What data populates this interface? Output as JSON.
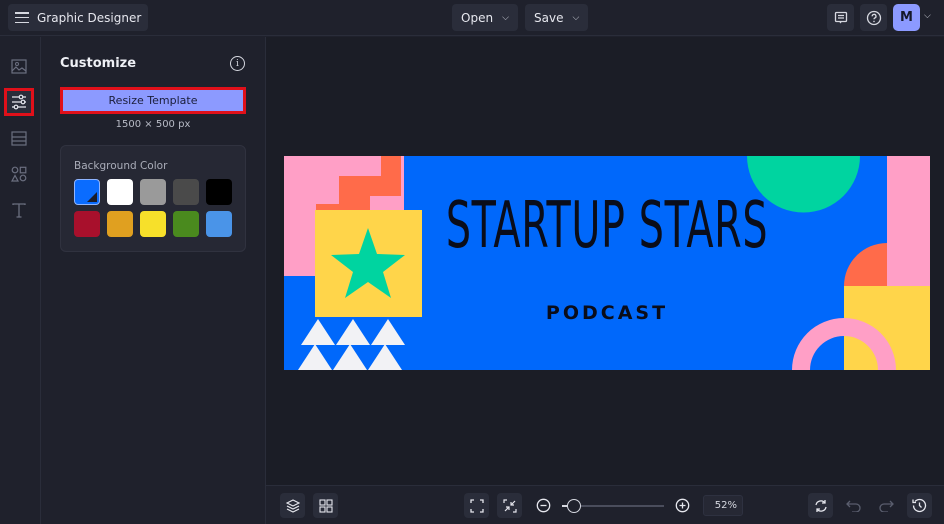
{
  "topbar": {
    "app_title": "Graphic Designer",
    "open_label": "Open",
    "save_label": "Save",
    "avatar_initial": "M",
    "icons": [
      "menu-icon",
      "feedback-icon",
      "help-icon",
      "chevron-down-icon"
    ]
  },
  "rail": {
    "items": [
      {
        "name": "image-icon",
        "active": false
      },
      {
        "name": "customize-sliders-icon",
        "active": true
      },
      {
        "name": "layout-icon",
        "active": false
      },
      {
        "name": "shapes-icon",
        "active": false
      },
      {
        "name": "text-icon",
        "active": false
      }
    ]
  },
  "panel": {
    "title": "Customize",
    "resize_label": "Resize Template",
    "dimensions": "1500 × 500 px",
    "background_color_label": "Background Color",
    "swatches": [
      {
        "color": "#0a6cff",
        "selected": true
      },
      {
        "color": "#ffffff",
        "selected": false
      },
      {
        "color": "#9a9a9a",
        "selected": false
      },
      {
        "color": "#4a4a4a",
        "selected": false
      },
      {
        "color": "#000000",
        "selected": false
      },
      {
        "color": "#a8102c",
        "selected": false
      },
      {
        "color": "#e0a020",
        "selected": false
      },
      {
        "color": "#f7e02a",
        "selected": false
      },
      {
        "color": "#4a8a1e",
        "selected": false
      },
      {
        "color": "#4a94e8",
        "selected": false
      }
    ]
  },
  "canvas": {
    "headline": "STARTUP STARS",
    "subline": "PODCAST",
    "colors": {
      "background": "#0068fb",
      "pink": "#ff9fc6",
      "orange": "#ff6b4a",
      "yellow": "#ffd54a",
      "green": "#00d4a0",
      "white": "#f2f2f5"
    }
  },
  "bottombar": {
    "zoom_level": "52%",
    "zoom_fraction": 0.12,
    "icons": [
      "layers-icon",
      "grid-icon",
      "fit-screen-icon",
      "shrink-icon",
      "zoom-out-icon",
      "zoom-in-icon",
      "sync-icon",
      "undo-icon",
      "redo-icon",
      "history-icon"
    ]
  }
}
